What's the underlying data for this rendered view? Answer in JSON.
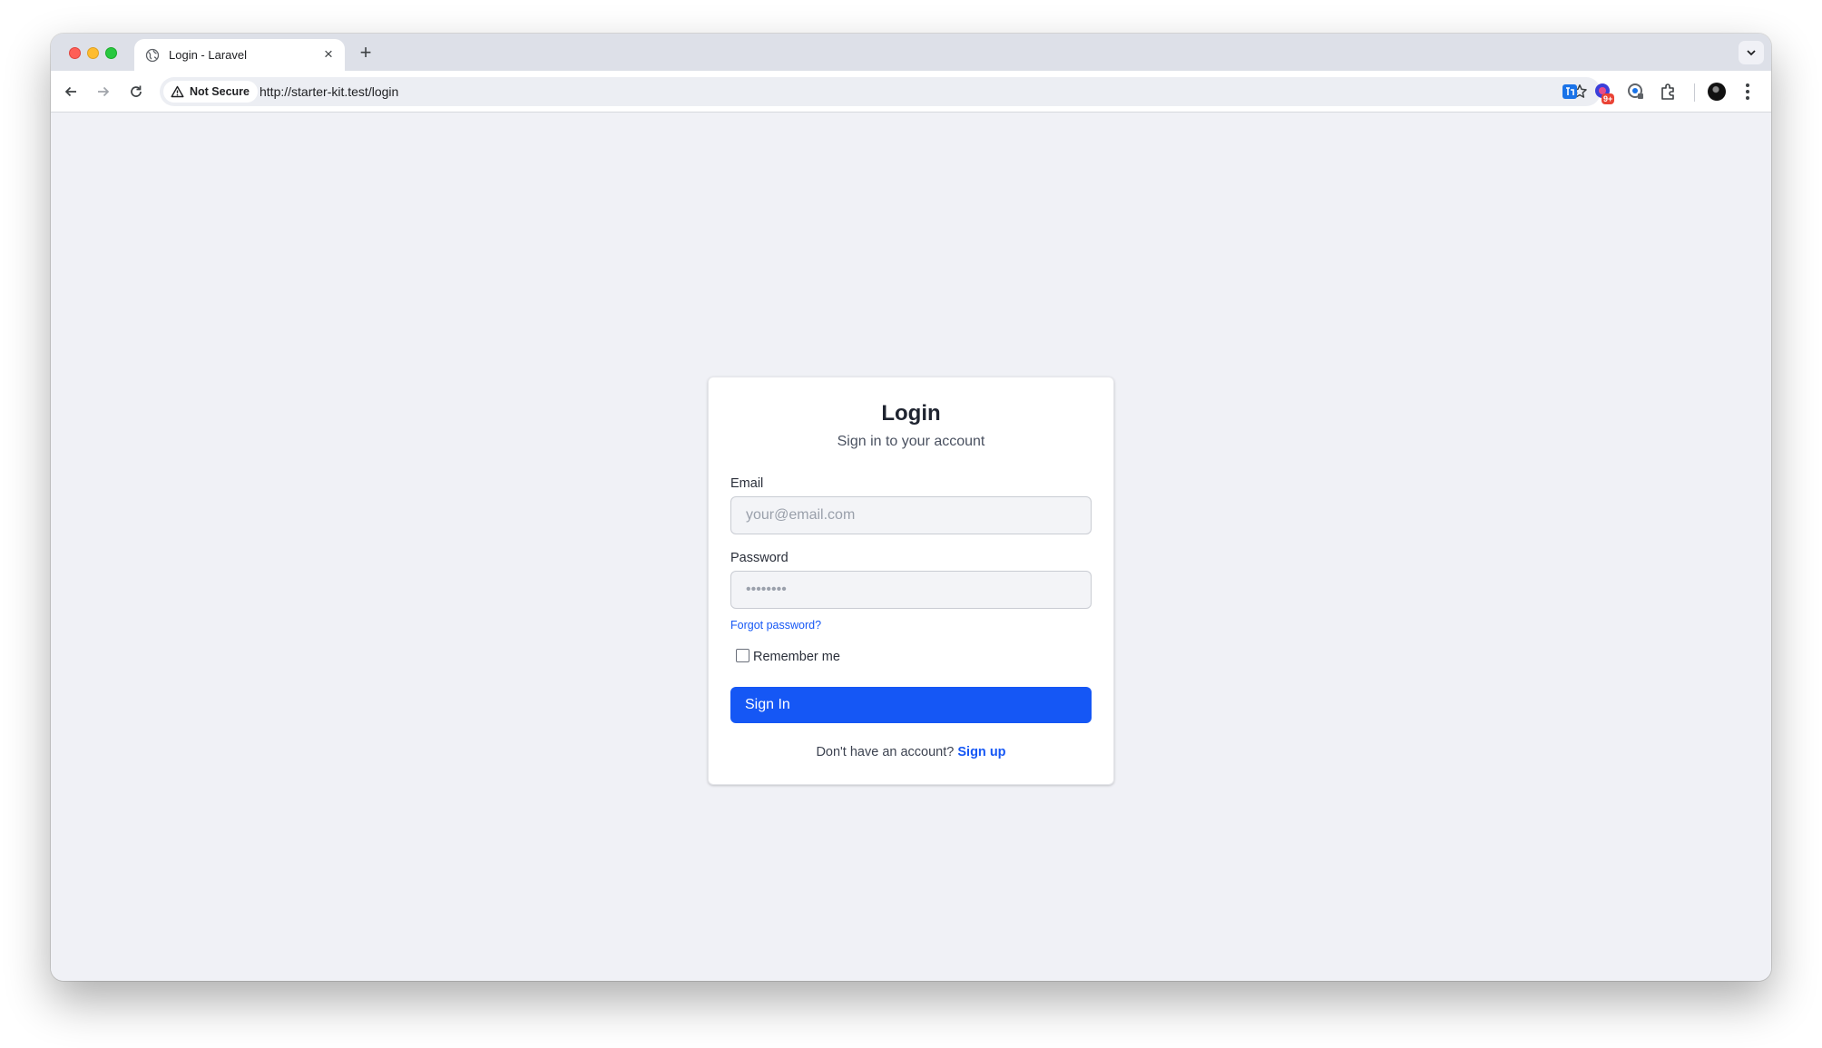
{
  "browser": {
    "tab_title": "Login - Laravel",
    "tab_close": "×",
    "new_tab": "+",
    "security_label": "Not Secure",
    "url": "http://starter-kit.test/login",
    "extension_badge": "9+"
  },
  "login": {
    "title": "Login",
    "subtitle": "Sign in to your account",
    "email_label": "Email",
    "email_placeholder": "your@email.com",
    "password_label": "Password",
    "password_placeholder": "••••••••",
    "forgot_link": "Forgot password?",
    "remember_label": "Remember me",
    "remember_checked": false,
    "submit_label": "Sign In",
    "signup_prompt": "Don't have an account?",
    "signup_link": "Sign up"
  },
  "colors": {
    "accent": "#1557f5",
    "page_background": "#f0f1f6",
    "card_background": "#ffffff"
  },
  "icons": [
    "globe-icon",
    "back-arrow-icon",
    "forward-arrow-icon",
    "reload-icon",
    "warning-icon",
    "star-icon",
    "translate-extension-icon",
    "badge-extension-icon",
    "lens-extension-icon",
    "puzzle-extension-icon",
    "profile-avatar",
    "kebab-menu-icon",
    "chevron-down-icon"
  ]
}
